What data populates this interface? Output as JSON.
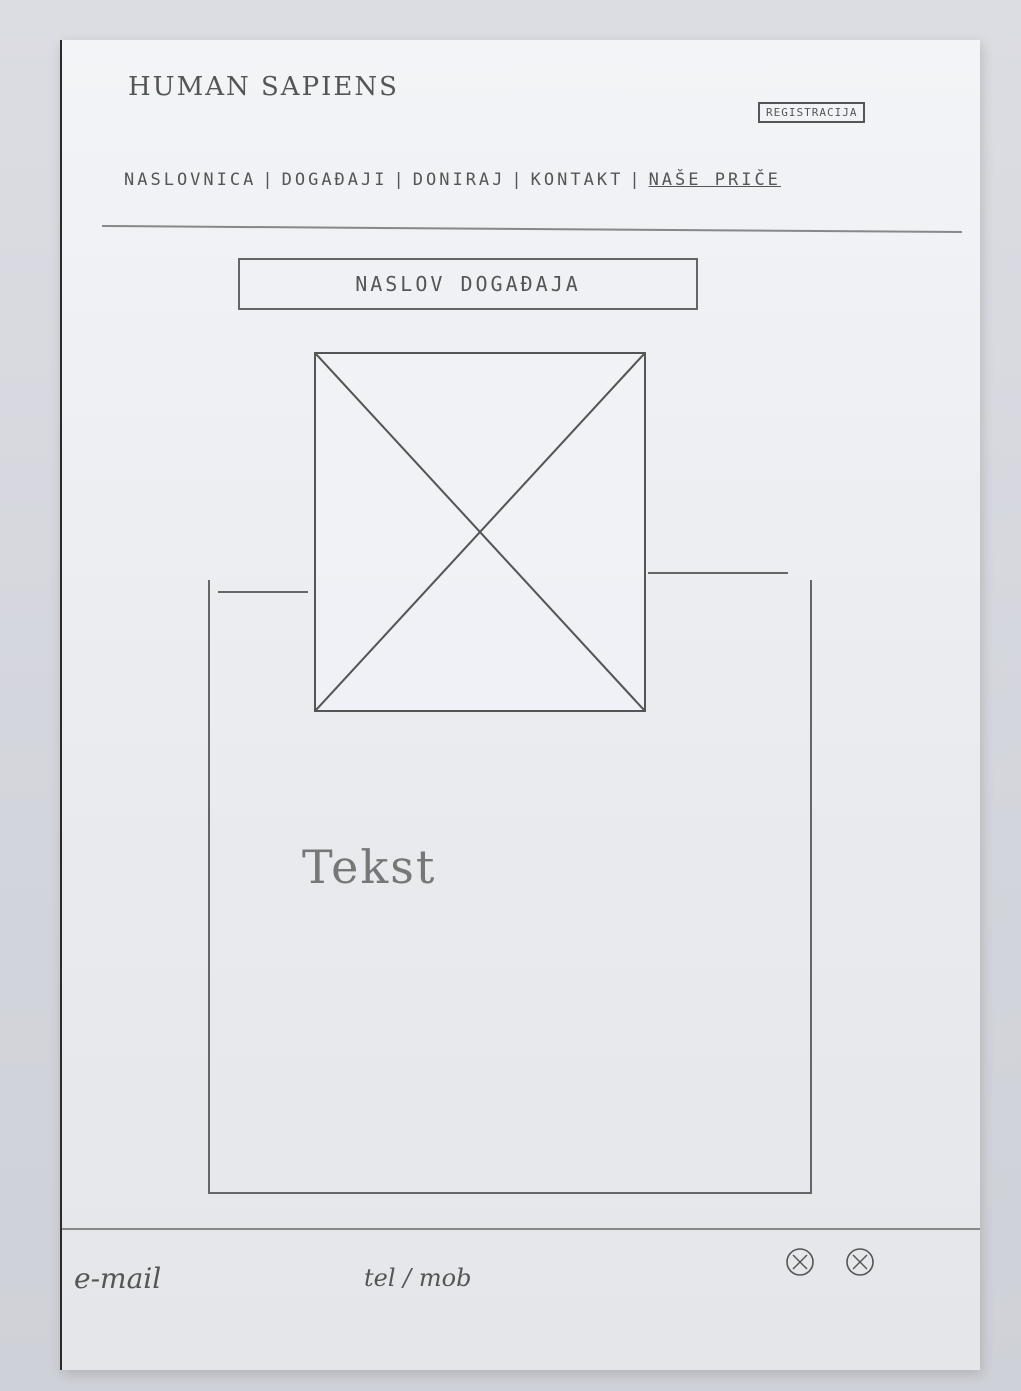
{
  "header": {
    "logo": "HUMAN SAPIENS",
    "register_label": "REGISTRACIJA"
  },
  "nav": {
    "items": [
      {
        "label": "NASLOVNICA",
        "active": false
      },
      {
        "label": "DOGAĐAJI",
        "active": false
      },
      {
        "label": "DONIRAJ",
        "active": false
      },
      {
        "label": "KONTAKT",
        "active": false
      },
      {
        "label": "NAŠE PRIČE",
        "active": true
      }
    ],
    "separator": "|"
  },
  "event": {
    "title": "NASLOV DOGAĐAJA",
    "body": "Tekst"
  },
  "footer": {
    "email": "e-mail",
    "phone": "tel / mob"
  },
  "icons": {
    "image_placeholder": "image-placeholder-icon",
    "social": [
      "social-icon",
      "social-icon"
    ]
  }
}
